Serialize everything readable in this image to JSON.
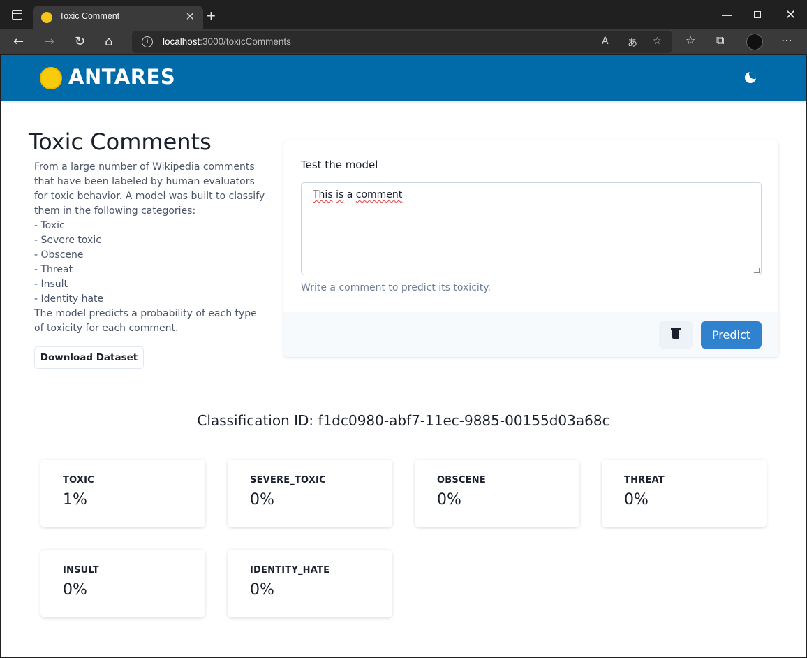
{
  "browser": {
    "tab_title": "Toxic Comment",
    "tab_close": "✕",
    "new_tab": "+",
    "url_host": "localhost",
    "url_path": ":3000/toxicComments",
    "window_min": "—",
    "window_close": "✕"
  },
  "header": {
    "brand": "ANTARES",
    "logo_color": "#f8cc0c",
    "bar_color": "#006ba8"
  },
  "main": {
    "title": "Toxic Comments",
    "description_lines": [
      "From a large number of Wikipedia comments",
      "that have been labeled by human evaluators",
      "for toxic behavior. A model was built to classify",
      "them in the following categories:",
      "- Toxic",
      "- Severe toxic",
      "- Obscene",
      "- Threat",
      "- Insult",
      "- Identity hate",
      "The model predicts a probability of each type",
      "of toxicity for each comment."
    ],
    "download_label": "Download Dataset"
  },
  "test": {
    "label": "Test the model",
    "text_word1": "This",
    "text_word2": "is",
    "text_word3": "a",
    "text_word4": "comment",
    "helper": "Write a comment to predict its toxicity.",
    "predict_label": "Predict",
    "accent": "#3182ce"
  },
  "results": {
    "classification_id": "Classification ID: f1dc0980-abf7-11ec-9885-00155d03a68c",
    "items": [
      {
        "name": "TOXIC",
        "value": "1%"
      },
      {
        "name": "SEVERE_TOXIC",
        "value": "0%"
      },
      {
        "name": "OBSCENE",
        "value": "0%"
      },
      {
        "name": "THREAT",
        "value": "0%"
      },
      {
        "name": "INSULT",
        "value": "0%"
      },
      {
        "name": "IDENTITY_HATE",
        "value": "0%"
      }
    ]
  }
}
